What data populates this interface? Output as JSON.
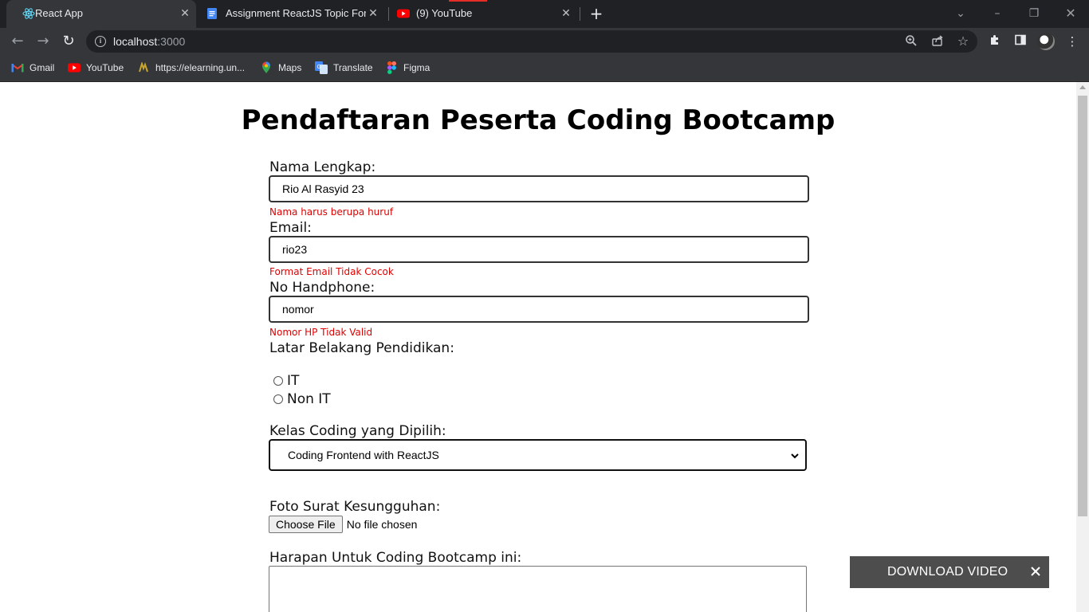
{
  "browser": {
    "tabs": [
      {
        "title": "React App",
        "icon": "react-icon",
        "active": true
      },
      {
        "title": "Assignment ReactJS Topic Form -",
        "icon": "google-docs-icon",
        "active": false
      },
      {
        "title": "(9) YouTube",
        "icon": "youtube-icon",
        "active": false
      }
    ],
    "address": {
      "host": "localhost",
      "port": ":3000"
    },
    "bookmarks": [
      {
        "label": "Gmail",
        "icon": "gmail-icon"
      },
      {
        "label": "YouTube",
        "icon": "youtube-icon"
      },
      {
        "label": "https://elearning.un...",
        "icon": "elearning-icon"
      },
      {
        "label": "Maps",
        "icon": "maps-icon"
      },
      {
        "label": "Translate",
        "icon": "translate-icon"
      },
      {
        "label": "Figma",
        "icon": "figma-icon"
      }
    ]
  },
  "form": {
    "title": "Pendaftaran Peserta Coding Bootcamp",
    "nama": {
      "label": "Nama Lengkap:",
      "value": "Rio Al Rasyid 23",
      "error": "Nama harus berupa huruf"
    },
    "email": {
      "label": "Email:",
      "value": "rio23",
      "error": "Format Email Tidak Cocok"
    },
    "hp": {
      "label": "No Handphone:",
      "value": "nomor",
      "error": "Nomor HP Tidak Valid"
    },
    "pendidikan": {
      "label": "Latar Belakang Pendidikan:",
      "options": [
        "IT",
        "Non IT"
      ]
    },
    "kelas": {
      "label": "Kelas Coding yang Dipilih:",
      "selected": "Coding Frontend with ReactJS"
    },
    "foto": {
      "label": "Foto Surat Kesungguhan:",
      "button": "Choose File",
      "status": "No file chosen"
    },
    "harapan": {
      "label": "Harapan Untuk Coding Bootcamp ini:",
      "value": ""
    }
  },
  "overlay": {
    "download_label": "DOWNLOAD VIDEO"
  },
  "colors": {
    "error": "#e00000",
    "chrome_dark": "#202124",
    "chrome_toolbar": "#35363a",
    "banner": "#4d4d4d"
  }
}
